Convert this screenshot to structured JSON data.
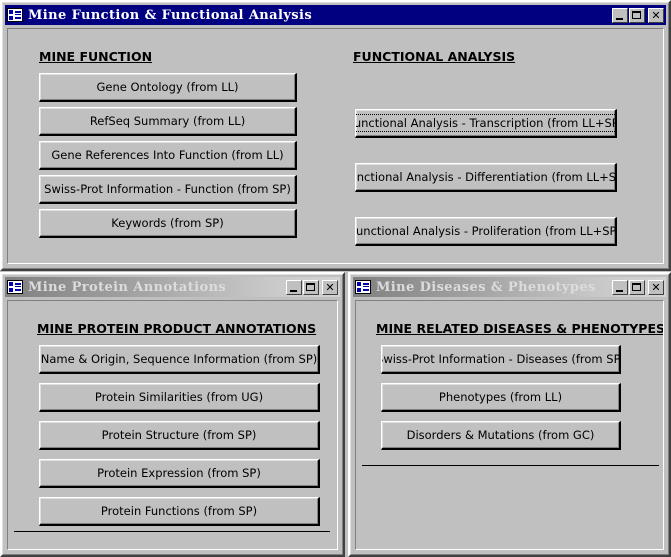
{
  "windows": {
    "main": {
      "title": "Mine Function & Functional Analysis",
      "icon": "form-list-icon",
      "state": "active",
      "controls": {
        "minimize": "minimize-button",
        "maximize": "maximize-button",
        "close_label": "✕"
      },
      "sections": [
        {
          "heading": "MINE FUNCTION",
          "buttons": [
            "Gene Ontology (from LL)",
            "RefSeq Summary (from LL)",
            "Gene References Into Function (from LL)",
            "Swiss-Prot Information - Function (from SP)",
            "Keywords (from SP)"
          ]
        },
        {
          "heading": "FUNCTIONAL ANALYSIS",
          "buttons": [
            "Functional Analysis - Transcription (from LL+SP)",
            "Functional Analysis - Differentiation (from LL+SP)",
            "Functional Analysis - Proliferation (from LL+SP)"
          ]
        }
      ]
    },
    "protein": {
      "title": "Mine Protein Annotations",
      "icon": "form-list-icon",
      "state": "inactive",
      "controls": {
        "minimize": "minimize-button",
        "maximize": "maximize-button",
        "close_label": "✕"
      },
      "sections": [
        {
          "heading": "MINE PROTEIN PRODUCT ANNOTATIONS",
          "buttons": [
            "Name & Origin, Sequence Information (from SP)",
            "Protein Similarities (from UG)",
            "Protein Structure (from SP)",
            "Protein Expression (from SP)",
            "Protein Functions (from SP)"
          ]
        }
      ]
    },
    "diseases": {
      "title": "Mine Diseases & Phenotypes",
      "icon": "form-list-icon",
      "state": "inactive",
      "controls": {
        "minimize": "minimize-button",
        "maximize": "maximize-button",
        "close_label": "✕"
      },
      "sections": [
        {
          "heading": "MINE RELATED DISEASES & PHENOTYPES",
          "buttons": [
            "Swiss-Prot Information - Diseases (from SP)",
            "Phenotypes (from LL)",
            "Disorders & Mutations (from GC)"
          ]
        }
      ]
    }
  },
  "colors": {
    "active_titlebar": "#000080",
    "face": "#c0c0c0",
    "active_title_text": "#ffffff",
    "inactive_title_text": "#dcdcdc",
    "button_text": "#000000"
  },
  "focus": {
    "focused_button": "Functional Analysis - Transcription (from LL+SP)"
  }
}
